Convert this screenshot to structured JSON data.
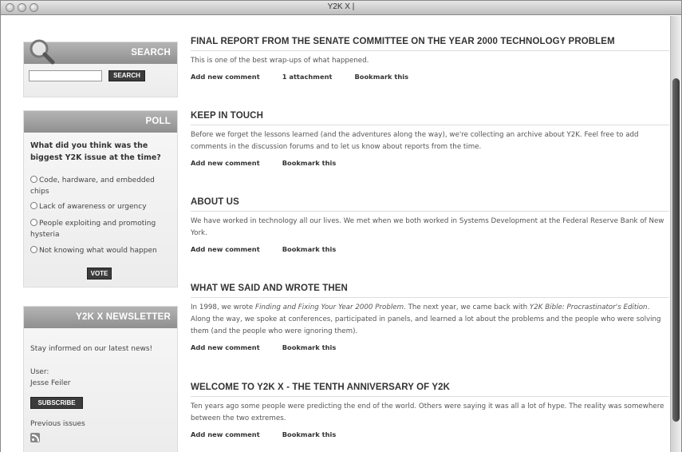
{
  "window": {
    "title": "Y2K X |"
  },
  "search": {
    "header": "SEARCH",
    "button": "SEARCH",
    "value": ""
  },
  "poll": {
    "header": "POLL",
    "question": "What did you think was the biggest Y2K issue at the time?",
    "options": [
      "Code, hardware, and embedded chips",
      "Lack of awareness or urgency",
      "People exploiting and promoting hysteria",
      "Not knowing what would happen"
    ],
    "vote_label": "VOTE"
  },
  "newsletter": {
    "header": "Y2K X NEWSLETTER",
    "intro": "Stay informed on our latest news!",
    "user_label": "User:",
    "user_name": "Jesse Feiler",
    "subscribe_label": "SUBSCRIBE",
    "previous_label": "Previous issues"
  },
  "nodes": [
    {
      "title": "FINAL REPORT FROM THE SENATE COMMITTEE ON THE YEAR 2000 TECHNOLOGY PROBLEM",
      "body": "This is one of the best wrap-ups of what happened.",
      "links": [
        "Add new comment",
        "1 attachment",
        "Bookmark this"
      ]
    },
    {
      "title": "KEEP IN TOUCH",
      "body": "Before we forget the lessons learned (and the adventures along the way), we're collecting an archive about Y2K. Feel free to add comments in the discussion forums and to let us know about reports from the time.",
      "links": [
        "Add new comment",
        "Bookmark this"
      ]
    },
    {
      "title": "ABOUT US",
      "body": "We have worked in technology all our lives. We met when we both worked in Systems Development at the Federal Reserve Bank of New York.",
      "links": [
        "Add new comment",
        "Bookmark this"
      ]
    },
    {
      "title": "WHAT WE SAID AND WROTE THEN",
      "body_parts": {
        "a": "In 1998, we wrote ",
        "b": "Finding and Fixing Your Year 2000 Problem",
        "c": ". The next year, we came back with ",
        "d": "Y2K Bible: Procrastinator's Edition",
        "e": ". Along the way, we spoke at conferences, participated in panels, and learned a lot about the problems and the people who were solving them (and the people who were ignoring them)."
      },
      "links": [
        "Add new comment",
        "Bookmark this"
      ]
    },
    {
      "title": "WELCOME TO Y2K X - THE TENTH ANNIVERSARY OF Y2K",
      "body": "Ten years ago some people were predicting the end of the world. Others were saying it was all a lot of hype. The reality was somewhere between the two extremes.",
      "links": [
        "Add new comment",
        "Bookmark this"
      ]
    }
  ]
}
